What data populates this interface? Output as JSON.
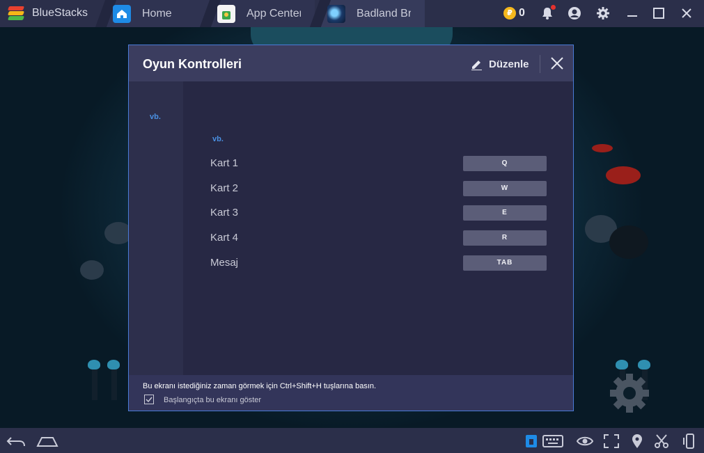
{
  "titlebar": {
    "brand": "BlueStacks",
    "tabs": [
      {
        "label": "Home",
        "icon": "home-icon"
      },
      {
        "label": "App Center",
        "icon": "app-center-icon"
      },
      {
        "label": "Badland Brawl",
        "icon": "badland-game-icon"
      }
    ],
    "coins": "0",
    "icons": [
      "coin-icon",
      "bell-icon",
      "account-icon",
      "gear-icon",
      "minimize-icon",
      "maximize-icon",
      "close-icon"
    ]
  },
  "dialog": {
    "title": "Oyun Kontrolleri",
    "edit_label": "Düzenle",
    "sidebar": {
      "items": [
        "vb."
      ]
    },
    "section_title": "vb.",
    "controls": [
      {
        "label": "Kart 1",
        "key": "Q"
      },
      {
        "label": "Kart 2",
        "key": "W"
      },
      {
        "label": "Kart 3",
        "key": "E"
      },
      {
        "label": "Kart 4",
        "key": "R"
      },
      {
        "label": "Mesaj",
        "key": "TAB"
      }
    ],
    "footer": {
      "hint": "Bu ekranı istediğiniz zaman görmek için Ctrl+Shift+H tuşlarına basın.",
      "checkbox_label": "Başlangıçta bu ekranı göster",
      "checkbox_checked": true
    }
  },
  "bottombar": {
    "icons": [
      "back-icon",
      "home-icon",
      "game-controls-icon",
      "keyboard-icon",
      "eye-icon",
      "fullscreen-icon",
      "location-icon",
      "cut-icon",
      "rotate-icon"
    ]
  },
  "colors": {
    "accent": "#4a90e2",
    "dialog_border": "#4a7bd8",
    "titlebar": "#2b2f4a"
  }
}
